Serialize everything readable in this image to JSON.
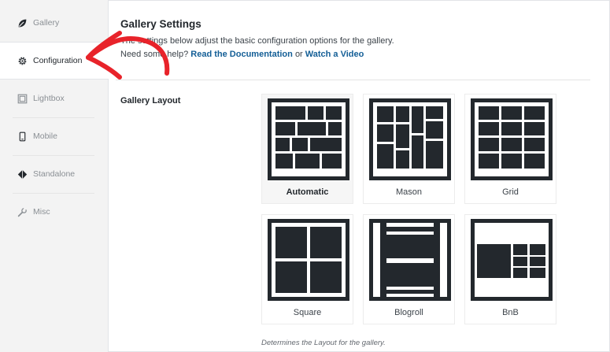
{
  "sidebar": {
    "items": [
      {
        "label": "Gallery",
        "icon": "leaf-icon",
        "active": false
      },
      {
        "label": "Configuration",
        "icon": "gear-icon",
        "active": true
      },
      {
        "label": "Lightbox",
        "icon": "lightbox-icon",
        "active": false
      },
      {
        "label": "Mobile",
        "icon": "mobile-icon",
        "active": false
      },
      {
        "label": "Standalone",
        "icon": "diamond-icon",
        "active": false
      },
      {
        "label": "Misc",
        "icon": "wrench-icon",
        "active": false
      }
    ]
  },
  "main": {
    "title": "Gallery Settings",
    "description": "The settings below adjust the basic configuration options for the gallery.",
    "help_prefix": "Need some help?",
    "doc_link": "Read the Documentation",
    "help_or": "or",
    "video_link": "Watch a Video",
    "field_label": "Gallery Layout",
    "layouts": [
      {
        "label": "Automatic",
        "selected": true
      },
      {
        "label": "Mason",
        "selected": false
      },
      {
        "label": "Grid",
        "selected": false
      },
      {
        "label": "Square",
        "selected": false
      },
      {
        "label": "Blogroll",
        "selected": false
      },
      {
        "label": "BnB",
        "selected": false
      }
    ],
    "help_text": "Determines the Layout for the gallery."
  },
  "colors": {
    "accent_link": "#135e96",
    "icon_dark": "#23282d",
    "annotation_red": "#e8232a"
  }
}
